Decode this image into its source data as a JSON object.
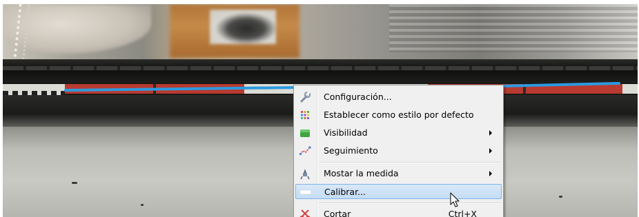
{
  "context_menu": {
    "items": [
      {
        "label": "Configuración...",
        "icon": "wrench-icon",
        "submenu": false
      },
      {
        "label": "Establecer como estilo por defecto",
        "icon": "palette-grid-icon",
        "submenu": false
      },
      {
        "label": "Visibilidad",
        "icon": "visibility-icon",
        "submenu": true
      },
      {
        "label": "Seguimiento",
        "icon": "tracking-icon",
        "submenu": true
      },
      {
        "label": "Mostar la medida",
        "icon": "measure-tool-icon",
        "submenu": true
      },
      {
        "label": "Calibrar...",
        "icon": "calibrate-icon",
        "submenu": false,
        "highlighted": true
      },
      {
        "label": "Cortar",
        "shortcut": "Ctrl+X",
        "icon": "cut-icon",
        "submenu": false
      }
    ]
  },
  "colors": {
    "menu_background": "#f0f0f0",
    "highlight": "#c4dcf3",
    "highlight_border": "#7eb4ea",
    "measurement_line": "#2b9be0"
  }
}
